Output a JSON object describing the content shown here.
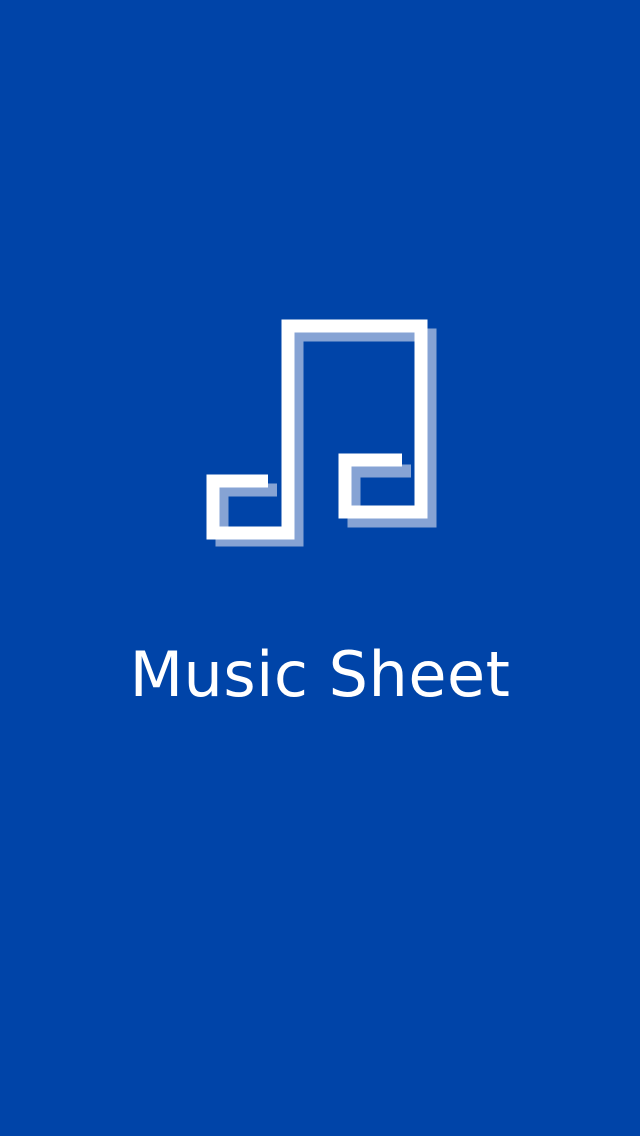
{
  "app": {
    "title": "Music Sheet",
    "icon": "music-note-icon"
  },
  "colors": {
    "background": "#0044a8",
    "icon_primary": "#ffffff",
    "icon_shadow": "#86a3d4",
    "text": "#ffffff"
  }
}
